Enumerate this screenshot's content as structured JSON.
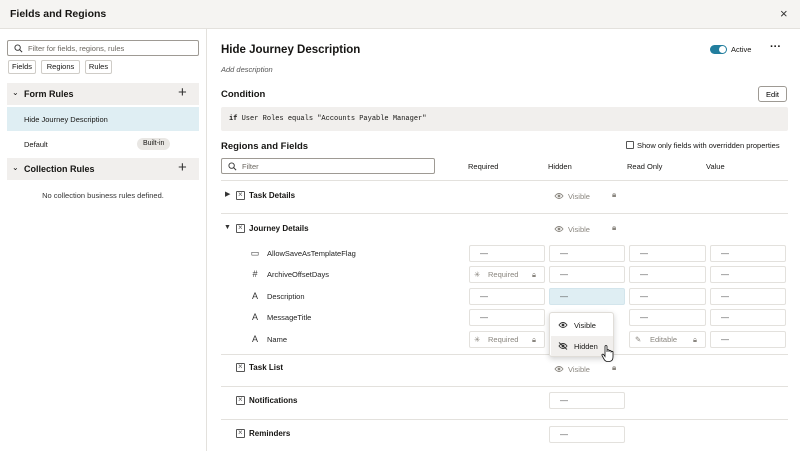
{
  "app": {
    "title": "Fields and Regions",
    "close_glyph": "×"
  },
  "left": {
    "search_placeholder": "Filter for fields, regions, rules",
    "chips": [
      "Fields",
      "Regions",
      "Rules"
    ],
    "form_rules": {
      "title": "Form Rules",
      "items": [
        {
          "label": "Hide Journey Description",
          "selected": true
        },
        {
          "label": "Default",
          "badge": "Built-in"
        }
      ]
    },
    "collection_rules": {
      "title": "Collection Rules",
      "empty_text": "No collection business rules defined."
    }
  },
  "rule": {
    "title": "Hide Journey Description",
    "add_description": "Add description",
    "active_label": "Active",
    "active": true,
    "more_glyph": "···"
  },
  "condition": {
    "title": "Condition",
    "edit_label": "Edit",
    "keyword": "if",
    "expression": "User Roles equals \"Accounts Payable Manager\""
  },
  "regions": {
    "title": "Regions and Fields",
    "override_label": "Show only fields with overridden properties",
    "filter_placeholder": "Filter",
    "columns": {
      "required": "Required",
      "hidden": "Hidden",
      "read_only": "Read Only",
      "value": "Value"
    },
    "dash": "—",
    "visible_text": "Visible",
    "required_text": "Required",
    "editable_text": "Editable",
    "groups": {
      "task_details": "Task Details",
      "journey_details": "Journey Details",
      "task_list": "Task List",
      "notifications": "Notifications",
      "reminders": "Reminders"
    },
    "fields": [
      "AllowSaveAsTemplateFlag",
      "ArchiveOffsetDays",
      "Description",
      "MessageTitle",
      "Name"
    ],
    "dropdown": {
      "visible": "Visible",
      "hidden": "Hidden"
    }
  },
  "colors": {
    "accent": "#227e9e",
    "selected_bg": "#dfeef3",
    "panel_bg": "#f1efed"
  },
  "icons": {
    "toggle": "▸▾",
    "field_types": [
      "toggle-field-icon",
      "number-field-icon",
      "text-field-icon",
      "text-field-icon",
      "text-field-icon"
    ]
  }
}
